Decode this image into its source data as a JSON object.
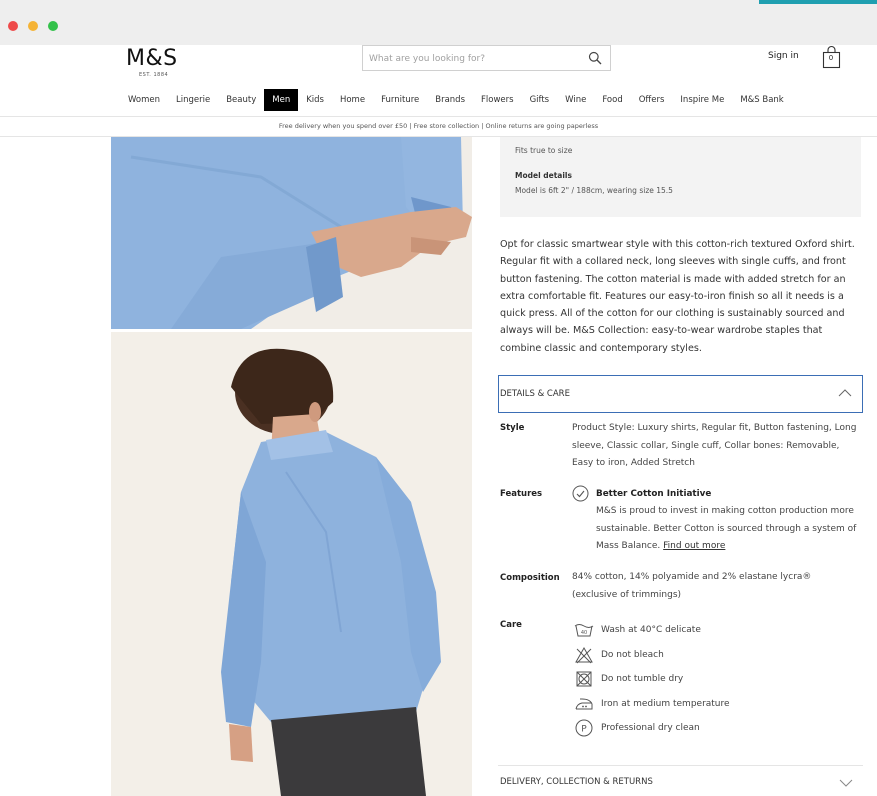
{
  "header": {
    "logo": "M&S",
    "logo_sub": "EST. 1884",
    "search_placeholder": "What are you looking for?",
    "sign_in": "Sign in",
    "bag_count": "0"
  },
  "nav": {
    "items": [
      "Women",
      "Lingerie",
      "Beauty",
      "Men",
      "Kids",
      "Home",
      "Furniture",
      "Brands",
      "Flowers",
      "Gifts",
      "Wine",
      "Food",
      "Offers",
      "Inspire Me",
      "M&S Bank"
    ],
    "active": "Men"
  },
  "promo_strip": "Free delivery when you spend over £50  |  Free store collection  |  Online returns are going paperless",
  "fit": {
    "text": "Fits true to size",
    "model_title": "Model details",
    "model_text": "Model is 6ft 2\" / 188cm, wearing size 15.5"
  },
  "description": "Opt for classic smartwear style with this cotton-rich textured Oxford shirt. Regular fit with a collared neck, long sleeves with single cuffs, and front button fastening. The cotton material is made with added stretch for an extra comfortable fit. Features our easy-to-iron finish so all it needs is a quick press. All of the cotton for our clothing is sustainably sourced and always will be. M&S Collection: easy-to-wear wardrobe staples that combine classic and contemporary styles.",
  "details": {
    "title": "DETAILS & CARE",
    "style_label": "Style",
    "style_value": "Product Style: Luxury shirts, Regular fit, Button fastening, Long sleeve, Classic collar, Single cuff, Collar bones: Removable, Easy to iron, Added Stretch",
    "features_label": "Features",
    "feature_title": "Better Cotton Initiative",
    "feature_text": "M&S is proud to invest in making cotton production more sustainable. Better Cotton is sourced through a system of Mass Balance.",
    "feature_link": "Find out more",
    "composition_label": "Composition",
    "composition_value": "84% cotton, 14% polyamide and 2% elastane lycra® (exclusive of trimmings)",
    "care_label": "Care",
    "care_items": [
      {
        "icon": "wash-40-icon",
        "text": "Wash at 40°C delicate"
      },
      {
        "icon": "no-bleach-icon",
        "text": "Do not bleach"
      },
      {
        "icon": "no-tumble-dry-icon",
        "text": "Do not tumble dry"
      },
      {
        "icon": "iron-medium-icon",
        "text": "Iron at medium temperature"
      },
      {
        "icon": "professional-dry-clean-icon",
        "text": "Professional dry clean"
      }
    ]
  },
  "delivery": {
    "title": "DELIVERY, COLLECTION & RETURNS"
  },
  "colors": {
    "accent_border": "#3b6eb5",
    "shirt_blue": "#8eb2dd",
    "browser_accent": "#1f9fb0"
  }
}
